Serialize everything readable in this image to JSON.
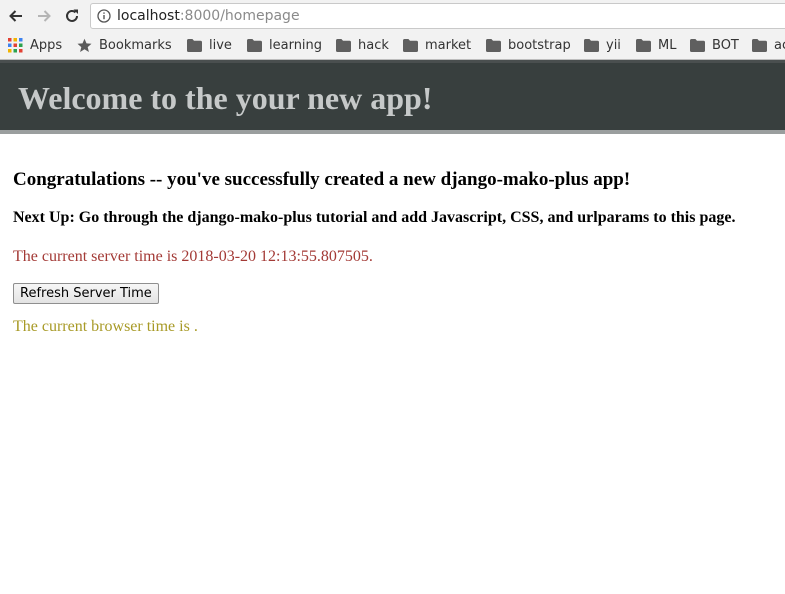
{
  "browser": {
    "url_host": "localhost",
    "url_path": ":8000/homepage",
    "bookmarks": [
      {
        "label": "Apps",
        "icon": "apps-grid-icon"
      },
      {
        "label": "Bookmarks",
        "icon": "star-icon"
      },
      {
        "label": "live",
        "icon": "folder-icon"
      },
      {
        "label": "learning",
        "icon": "folder-icon"
      },
      {
        "label": "hack",
        "icon": "folder-icon"
      },
      {
        "label": "market",
        "icon": "folder-icon"
      },
      {
        "label": "bootstrap",
        "icon": "folder-icon"
      },
      {
        "label": "yii",
        "icon": "folder-icon"
      },
      {
        "label": "ML",
        "icon": "folder-icon"
      },
      {
        "label": "BOT",
        "icon": "folder-icon"
      },
      {
        "label": "ac",
        "icon": "folder-icon"
      }
    ]
  },
  "page": {
    "header_title": "Welcome to the your new app!",
    "congrats": "Congratulations -- you've successfully created a new django-mako-plus app!",
    "next_up": "Next Up: Go through the django-mako-plus tutorial and add Javascript, CSS, and urlparams to this page.",
    "server_time": "The current server time is 2018-03-20 12:13:55.807505.",
    "refresh_button": "Refresh Server Time",
    "browser_time": "The current browser time is ."
  },
  "colors": {
    "header_bg": "#383f3e",
    "header_text": "#c6c9c9",
    "server_time": "#a33a36",
    "browser_time": "#a89a27"
  }
}
